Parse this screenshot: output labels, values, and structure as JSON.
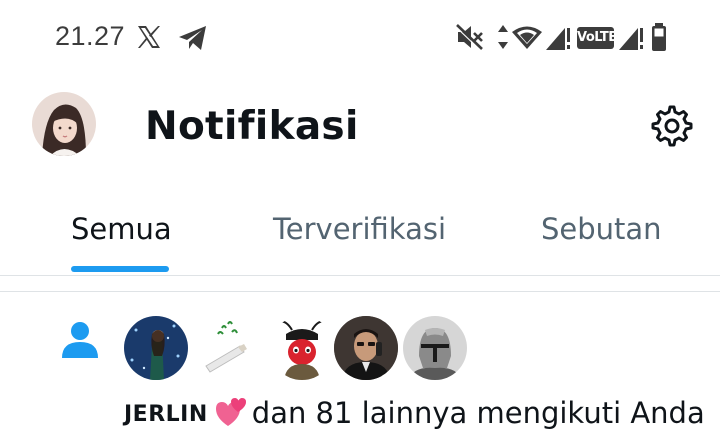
{
  "status_bar": {
    "time": "21.27",
    "icons": [
      "x-logo-icon",
      "telegram-icon",
      "mute-icon",
      "data-arrows-icon",
      "wifi-icon",
      "signal-icon",
      "volte-badge",
      "signal-icon",
      "battery-icon"
    ],
    "volte_label": "VoLTE"
  },
  "header": {
    "title": "Notifikasi",
    "avatar_icon": "profile-avatar",
    "settings_icon": "gear-icon"
  },
  "tabs": [
    {
      "label": "Semua",
      "active": true
    },
    {
      "label": "Terverifikasi",
      "active": false
    },
    {
      "label": "Sebutan",
      "active": false
    }
  ],
  "notification": {
    "type_icon": "person-icon",
    "follower_avatars": [
      "avatar-1",
      "avatar-2",
      "avatar-3",
      "avatar-4",
      "avatar-5"
    ],
    "name": "JERLIN",
    "emoji": "two-hearts-icon",
    "text": "dan 81 lainnya mengikuti Anda"
  },
  "colors": {
    "accent": "#1d9bf0",
    "text_primary": "#0f1419",
    "text_secondary": "#536471",
    "divider": "#dfe3e6"
  }
}
